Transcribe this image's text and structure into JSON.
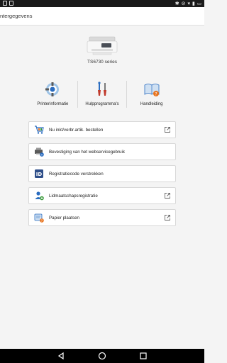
{
  "app": {
    "title": "ntergegevens"
  },
  "printer": {
    "model": "TS6730 series"
  },
  "topnav": [
    {
      "label": "Printerinformatie",
      "icon": "printer-info-icon"
    },
    {
      "label": "Hulpprogramma's",
      "icon": "tools-icon"
    },
    {
      "label": "Handleiding",
      "icon": "manual-icon"
    }
  ],
  "menu": [
    {
      "label": "Nu inkt/verbr.artik. bestellen",
      "icon": "shopping-cart-icon",
      "external": true
    },
    {
      "label": "Bevestiging van het webservicegebruik",
      "icon": "printer-status-icon",
      "external": false
    },
    {
      "label": "Registratiecode verstrekken",
      "icon": "id-icon",
      "external": false
    },
    {
      "label": "Lidmaatschapsregistratie",
      "icon": "add-member-icon",
      "external": true
    },
    {
      "label": "Papier plaatsen",
      "icon": "paper-icon",
      "external": true
    }
  ],
  "colors": {
    "accent": "#2a6cc0",
    "warning": "#e8731d",
    "background": "#f4f4f4"
  }
}
